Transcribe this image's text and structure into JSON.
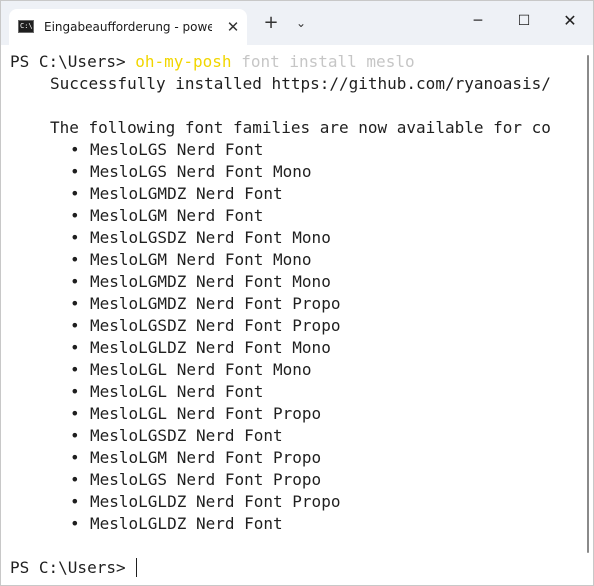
{
  "window": {
    "tab_title": "Eingabeaufforderung - power",
    "tab_icon": "command-prompt-icon",
    "tab_icon_text": "C:\\.",
    "close_tab_symbol": "✕",
    "new_tab_symbol": "+",
    "dropdown_symbol": "⌄",
    "minimize_symbol": "─",
    "maximize_symbol": "☐",
    "close_symbol": "✕"
  },
  "terminal": {
    "prompt": "PS C:\\Users> ",
    "command": {
      "name": "oh-my-posh",
      "args": " font install meslo"
    },
    "colors": {
      "command": "#f1d600",
      "args": "#c6c6c6",
      "text": "#1f1f1f"
    },
    "success_message": "Successfully installed https://github.com/ryanoasis/",
    "families_heading": "The following font families are now available for co",
    "bullet_symbol": "•",
    "fonts": [
      "MesloLGS Nerd Font",
      "MesloLGS Nerd Font Mono",
      "MesloLGMDZ Nerd Font",
      "MesloLGM Nerd Font",
      "MesloLGSDZ Nerd Font Mono",
      "MesloLGM Nerd Font Mono",
      "MesloLGMDZ Nerd Font Mono",
      "MesloLGMDZ Nerd Font Propo",
      "MesloLGSDZ Nerd Font Propo",
      "MesloLGLDZ Nerd Font Mono",
      "MesloLGL Nerd Font Mono",
      "MesloLGL Nerd Font",
      "MesloLGL Nerd Font Propo",
      "MesloLGSDZ Nerd Font",
      "MesloLGM Nerd Font Propo",
      "MesloLGS Nerd Font Propo",
      "MesloLGLDZ Nerd Font Propo",
      "MesloLGLDZ Nerd Font"
    ],
    "final_prompt": "PS C:\\Users> "
  }
}
